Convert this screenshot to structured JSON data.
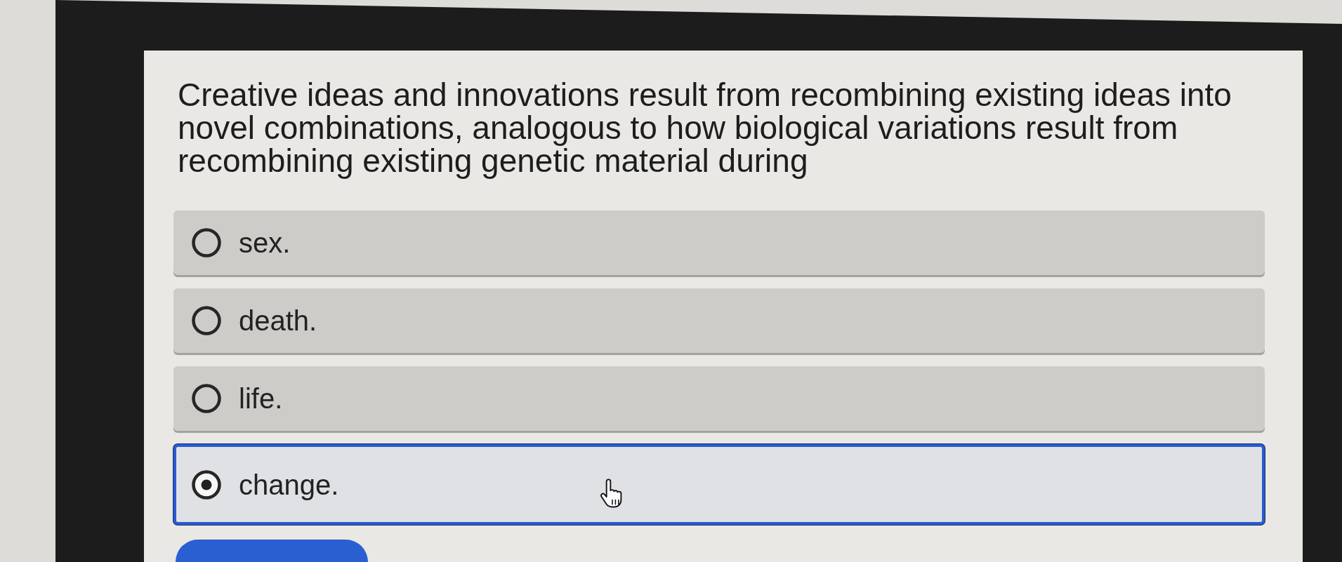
{
  "question": {
    "text": "Creative ideas and innovations result from recombining existing ideas into novel combinations, analogous to how biological variations result from recombining existing genetic material during"
  },
  "options": [
    {
      "label": "sex.",
      "selected": false
    },
    {
      "label": "death.",
      "selected": false
    },
    {
      "label": "life.",
      "selected": false
    },
    {
      "label": "change.",
      "selected": true
    }
  ]
}
